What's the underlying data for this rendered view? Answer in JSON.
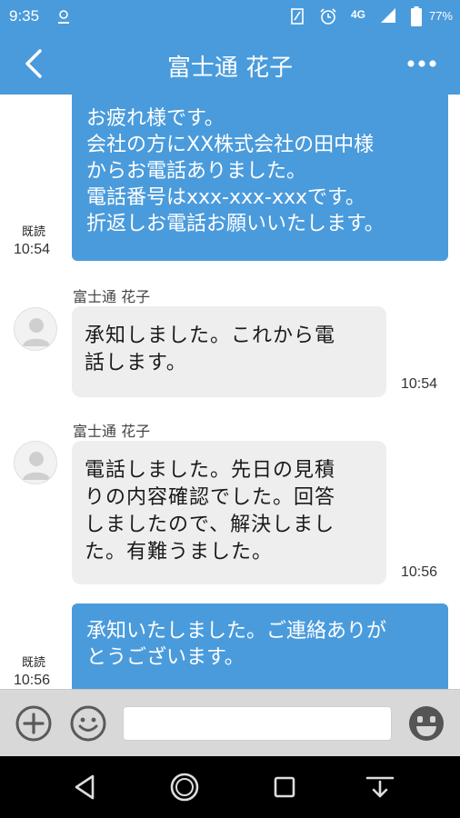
{
  "status_bar": {
    "time": "9:35",
    "network": "4G",
    "battery": "77%",
    "icons": [
      "notification-icon",
      "nfc-icon",
      "alarm-icon",
      "signal-icon",
      "battery-icon"
    ]
  },
  "header": {
    "title": "富士通 花子",
    "back_icon": "back-chevron-icon",
    "more_icon": "more-options-icon"
  },
  "messages": [
    {
      "direction": "outgoing",
      "text": "お疲れ様です。\n会社の方にXX株式会社の田中様\nからお電話ありました。\n電話番号はxxx-xxx-xxxです。\n折返しお電話お願いいたします。",
      "read": "既読",
      "time": "10:54"
    },
    {
      "direction": "incoming",
      "sender": "富士通 花子",
      "text": "承知しました。これから電\n話します。",
      "time": "10:54"
    },
    {
      "direction": "incoming",
      "sender": "富士通 花子",
      "text": "電話しました。先日の見積\nりの内容確認でした。回答\nしましたので、解決しまし\nた。有難うました。",
      "time": "10:56"
    },
    {
      "direction": "outgoing",
      "text": "承知いたしました。ご連絡ありが\nとうございます。",
      "read": "既読",
      "time": "10:56"
    }
  ],
  "input_bar": {
    "add_icon": "plus-circle-icon",
    "emoji_icon": "smiley-icon",
    "message_value": "",
    "sticker_icon": "sticker-face-icon"
  },
  "nav_bar": {
    "icons": [
      "back-triangle-icon",
      "home-circle-icon",
      "recents-square-icon",
      "notification-pull-icon"
    ]
  },
  "colors": {
    "accent": "#4a9bdc",
    "incoming_bubble": "#eeeeee",
    "input_bar_bg": "#d8d8d8"
  }
}
